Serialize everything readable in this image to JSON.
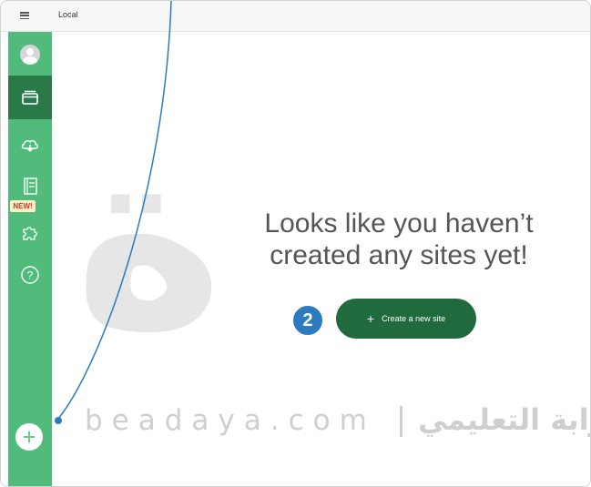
{
  "window": {
    "title": "Local"
  },
  "sidebar": {
    "items": [
      {
        "name": "user-account",
        "icon": "avatar-icon"
      },
      {
        "name": "local-sites",
        "icon": "sites-icon",
        "active": true
      },
      {
        "name": "cloud-backups",
        "icon": "cloud-icon"
      },
      {
        "name": "blueprints",
        "icon": "blueprint-icon"
      },
      {
        "name": "add-ons",
        "icon": "puzzle-icon"
      },
      {
        "name": "help",
        "icon": "help-icon"
      }
    ],
    "new_badge": "NEW!",
    "add_icon": "plus-icon"
  },
  "main": {
    "empty_line1": "Looks like you haven’t",
    "empty_line2": "created any sites yet!",
    "create_button_icon": "+",
    "create_button_label": "Create a new site"
  },
  "annotation": {
    "step": "2",
    "color": "#2c7bbf"
  },
  "watermark": {
    "latin": "beadaya.com",
    "arabic": "بوابة التعليمي"
  },
  "colors": {
    "sidebar": "#51bb7b",
    "sidebar_active": "#2a7a49",
    "button": "#206a3e",
    "accent": "#2c7bbf"
  }
}
